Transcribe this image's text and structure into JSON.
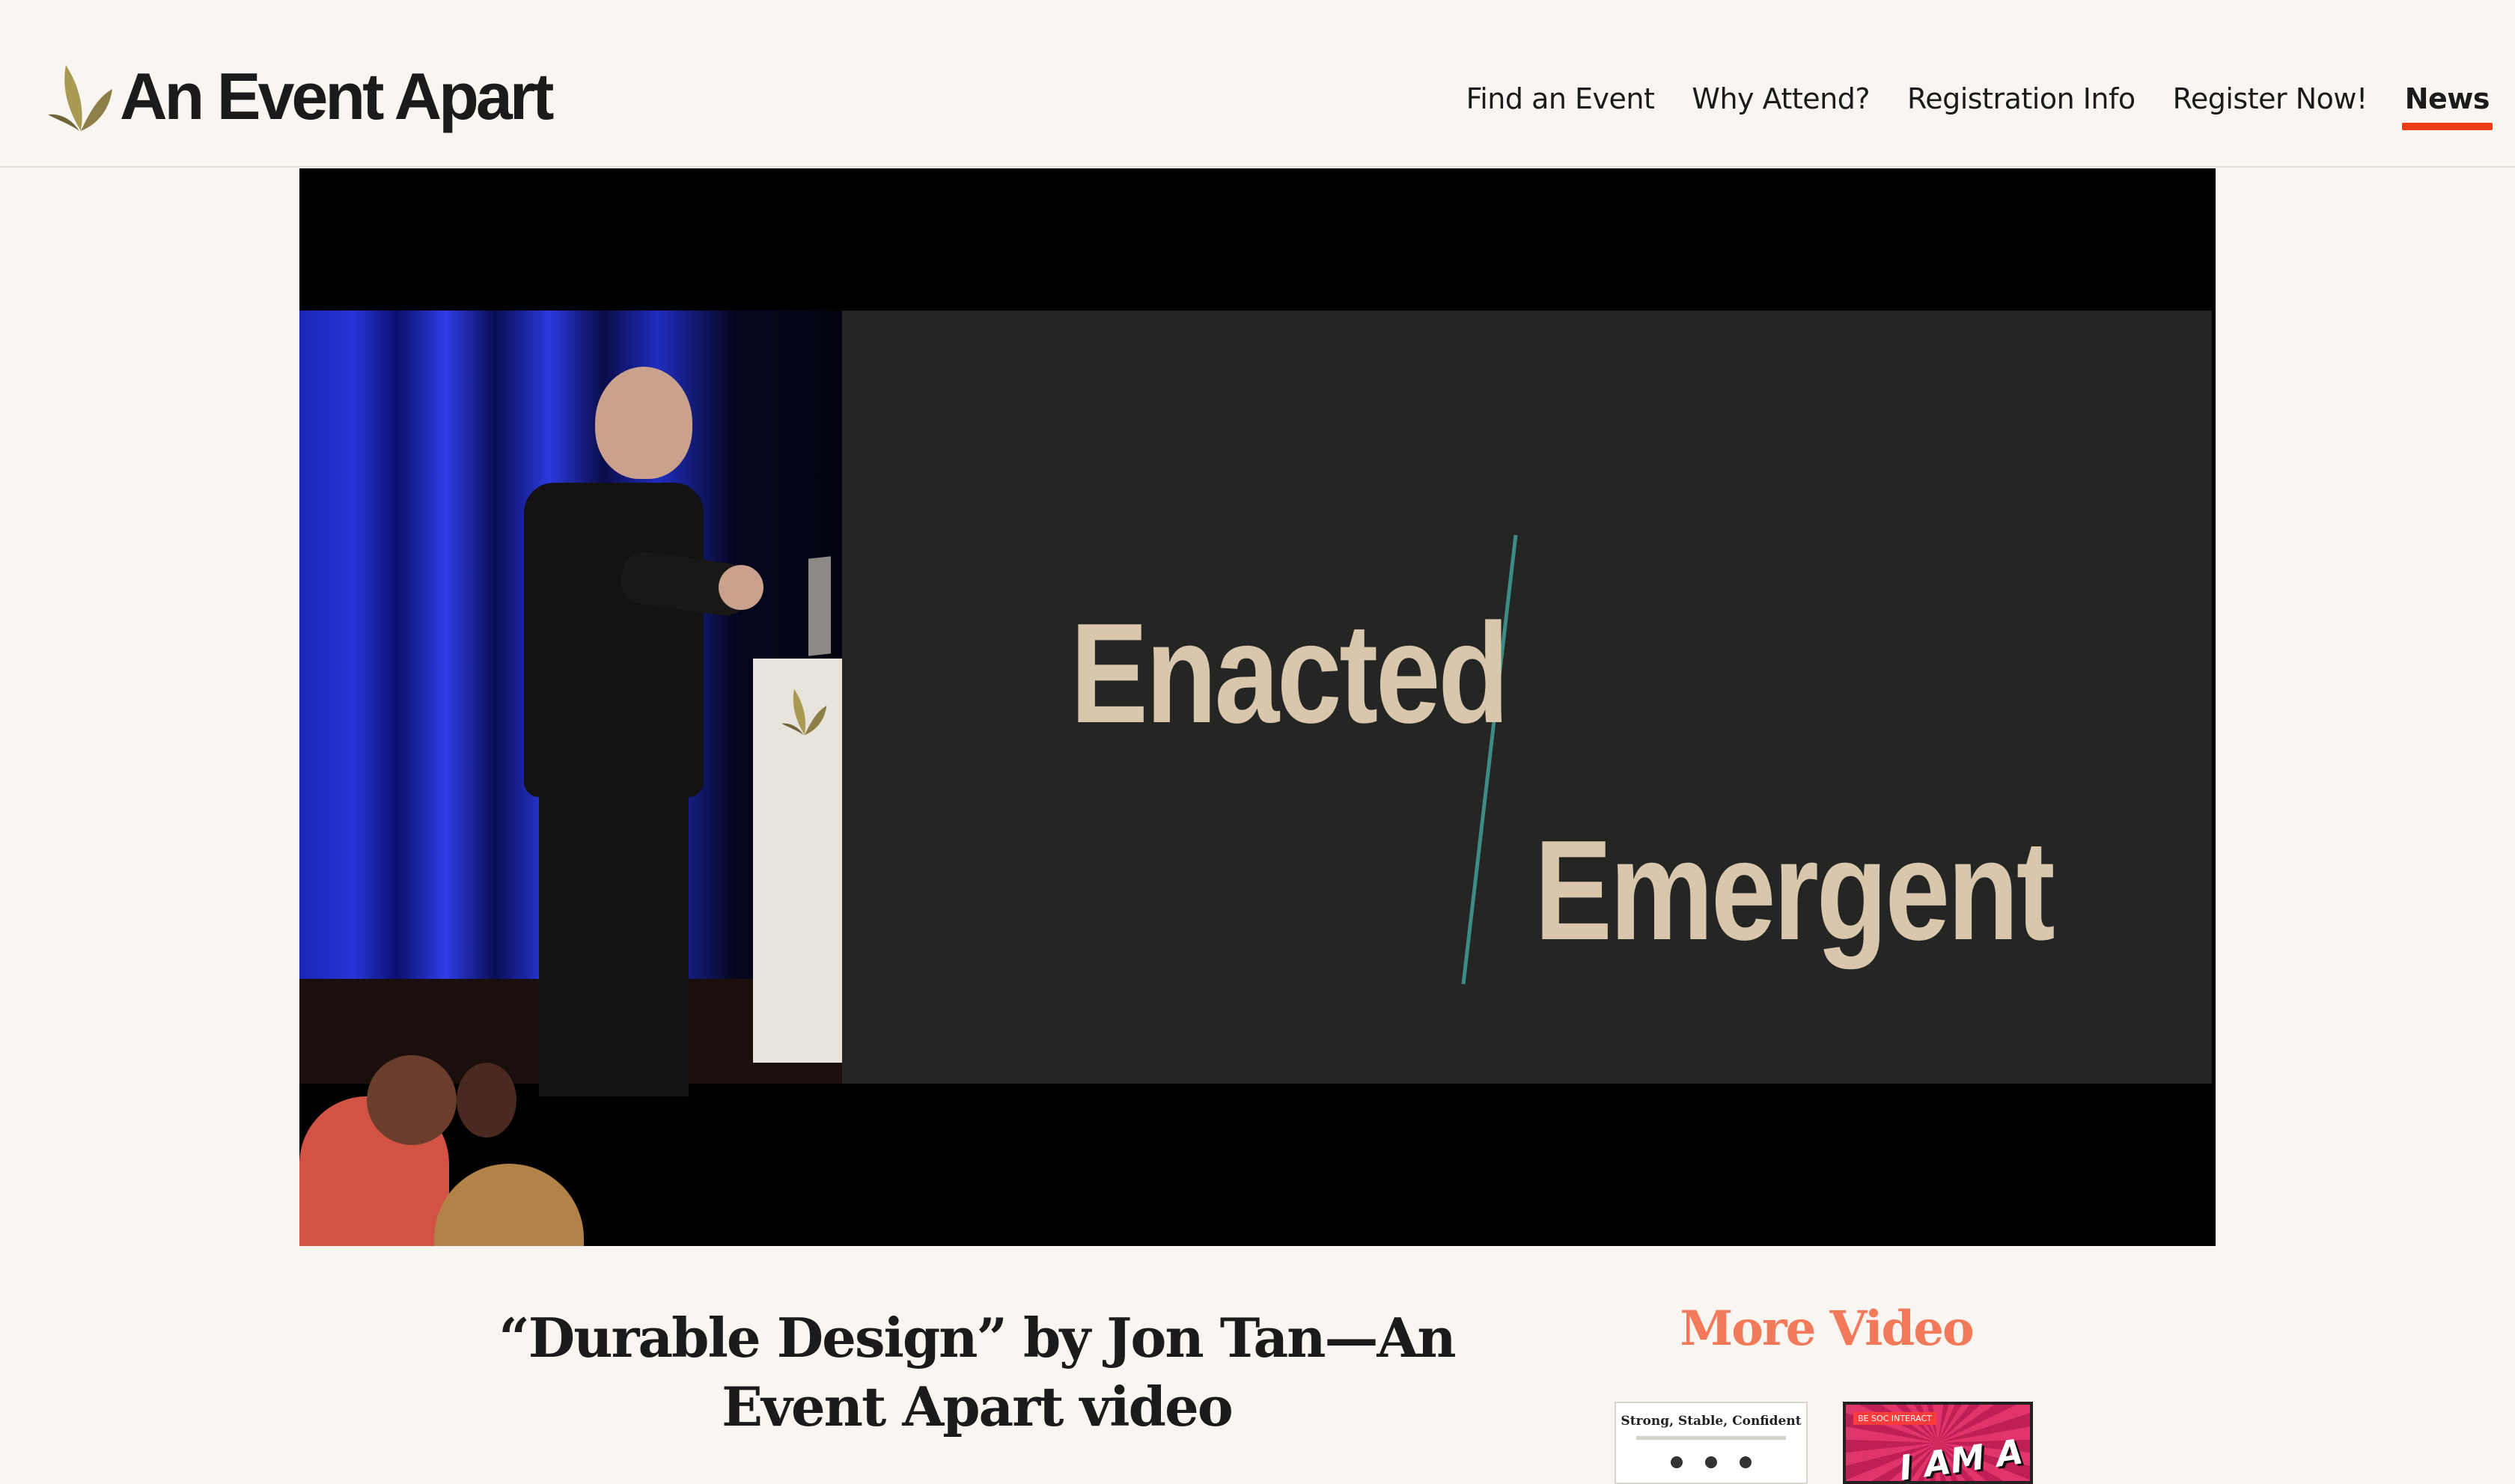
{
  "site": {
    "logo_text": "An Event Apart"
  },
  "nav": {
    "items": [
      {
        "label": "Find an Event",
        "active": false
      },
      {
        "label": "Why Attend?",
        "active": false
      },
      {
        "label": "Registration Info",
        "active": false
      },
      {
        "label": "Register Now!",
        "active": false
      },
      {
        "label": "News",
        "active": true
      }
    ]
  },
  "video": {
    "slide_word_1": "Enacted",
    "slide_word_2": "Emergent"
  },
  "article": {
    "title": "“Durable Design” by Jon Tan—An Event Apart video"
  },
  "sidebar": {
    "heading": "More Video",
    "thumbs": [
      {
        "title": "Strong, Stable, Confident"
      },
      {
        "badge": "BE SOC INTERACT",
        "text": "I AM A NERD!"
      }
    ]
  },
  "colors": {
    "accent": "#ef3d16",
    "more_video": "#f27a5a",
    "background": "#f9f6f1",
    "logo_leaf": "#8c8048"
  }
}
